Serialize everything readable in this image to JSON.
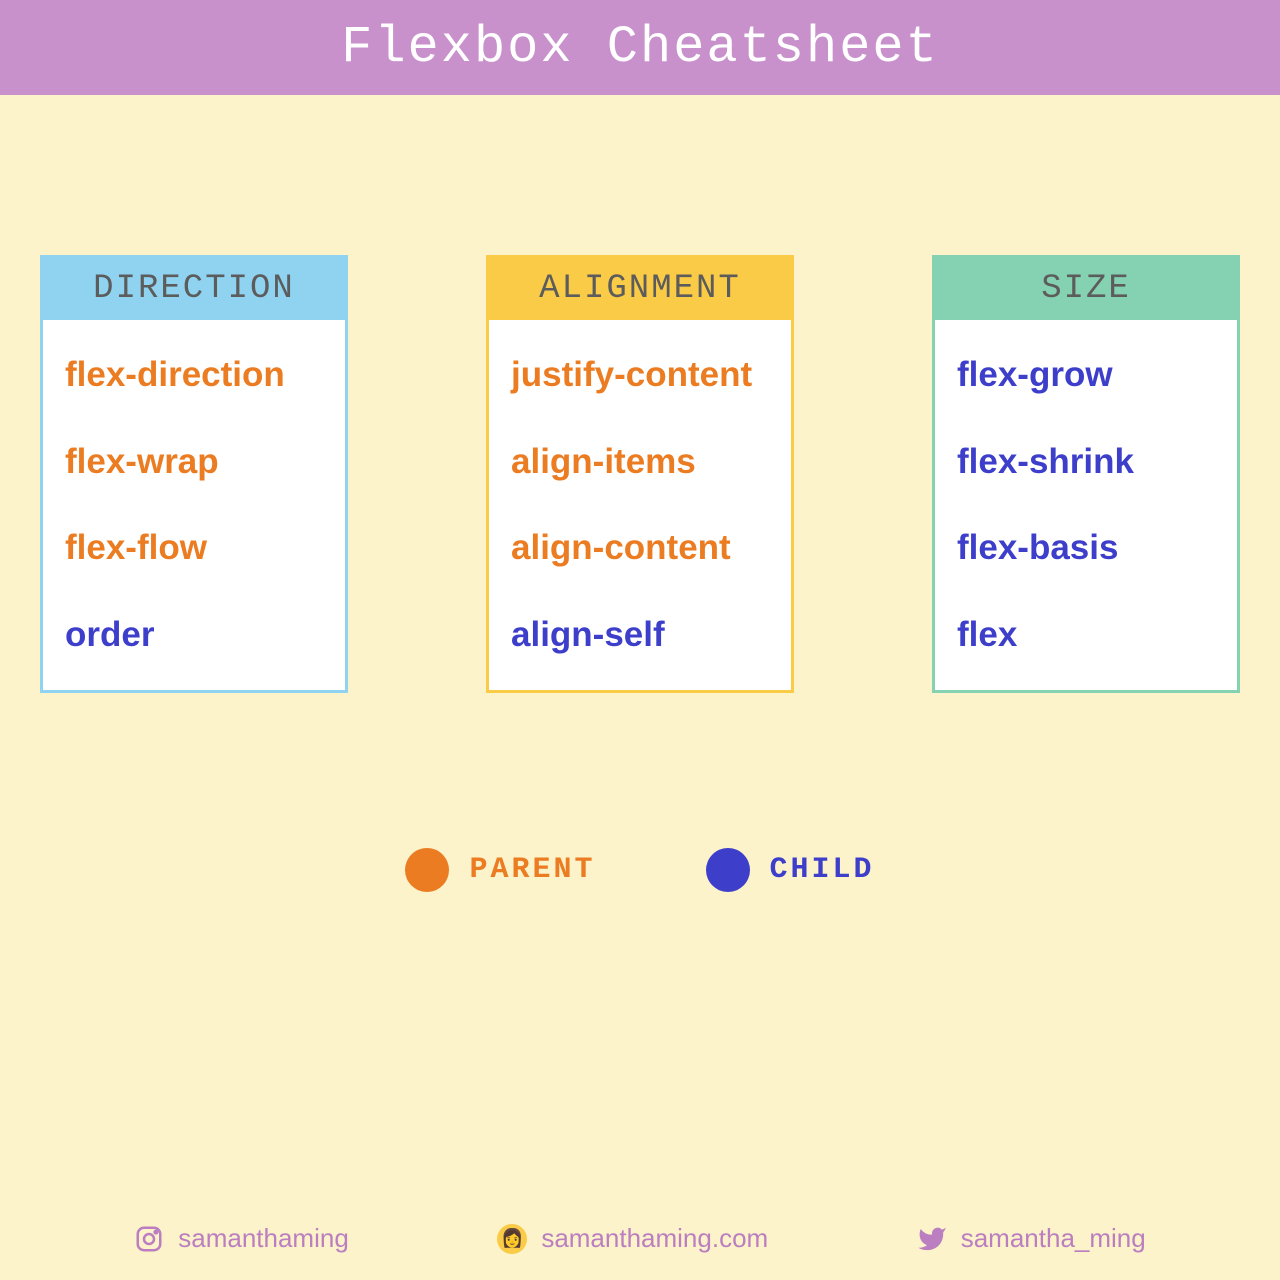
{
  "header": {
    "title": "Flexbox Cheatsheet"
  },
  "colors": {
    "parent": "#EB7C22",
    "child": "#3D3FCB",
    "bg": "#FCF3CA",
    "headerBg": "#C891CB"
  },
  "cards": [
    {
      "header": "DIRECTION",
      "props": [
        {
          "name": "flex-direction",
          "role": "parent"
        },
        {
          "name": "flex-wrap",
          "role": "parent"
        },
        {
          "name": "flex-flow",
          "role": "parent"
        },
        {
          "name": "order",
          "role": "child"
        }
      ]
    },
    {
      "header": "ALIGNMENT",
      "props": [
        {
          "name": "justify-content",
          "role": "parent"
        },
        {
          "name": "align-items",
          "role": "parent"
        },
        {
          "name": "align-content",
          "role": "parent"
        },
        {
          "name": "align-self",
          "role": "child"
        }
      ]
    },
    {
      "header": "SIZE",
      "props": [
        {
          "name": "flex-grow",
          "role": "child"
        },
        {
          "name": "flex-shrink",
          "role": "child"
        },
        {
          "name": "flex-basis",
          "role": "child"
        },
        {
          "name": "flex",
          "role": "child"
        }
      ]
    }
  ],
  "legend": {
    "parent_label": "PARENT",
    "child_label": "CHILD"
  },
  "footer": {
    "instagram": "samanthaming",
    "website": "samanthaming.com",
    "twitter": "samantha_ming"
  }
}
